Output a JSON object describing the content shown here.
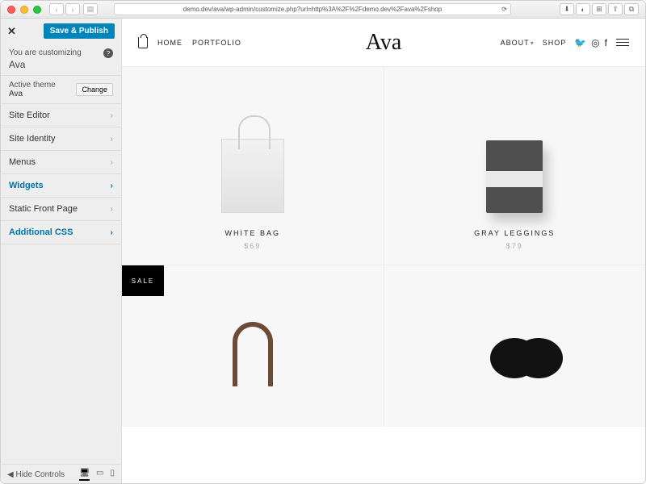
{
  "browser": {
    "url": "demo.dev/ava/wp-admin/customize.php?url=http%3A%2F%2Fdemo.dev%2Fava%2Fshop"
  },
  "sidebar": {
    "save_label": "Save & Publish",
    "customizing_label": "You are customizing",
    "site_name": "Ava",
    "active_theme_label": "Active theme",
    "theme_name": "Ava",
    "change_label": "Change",
    "items": [
      {
        "label": "Site Editor"
      },
      {
        "label": "Site Identity"
      },
      {
        "label": "Menus"
      },
      {
        "label": "Widgets"
      },
      {
        "label": "Static Front Page"
      },
      {
        "label": "Additional CSS"
      }
    ],
    "hide_controls_label": "Hide Controls"
  },
  "shop": {
    "nav_left": [
      "HOME",
      "PORTFOLIO"
    ],
    "logo_text": "Ava",
    "nav_right": [
      {
        "label": "ABOUT",
        "caret": true
      },
      {
        "label": "SHOP",
        "caret": false
      }
    ],
    "products": [
      {
        "title": "WHITE BAG",
        "price": "$69"
      },
      {
        "title": "GRAY LEGGINGS",
        "price": "$79"
      }
    ],
    "sale_label": "SALE"
  }
}
